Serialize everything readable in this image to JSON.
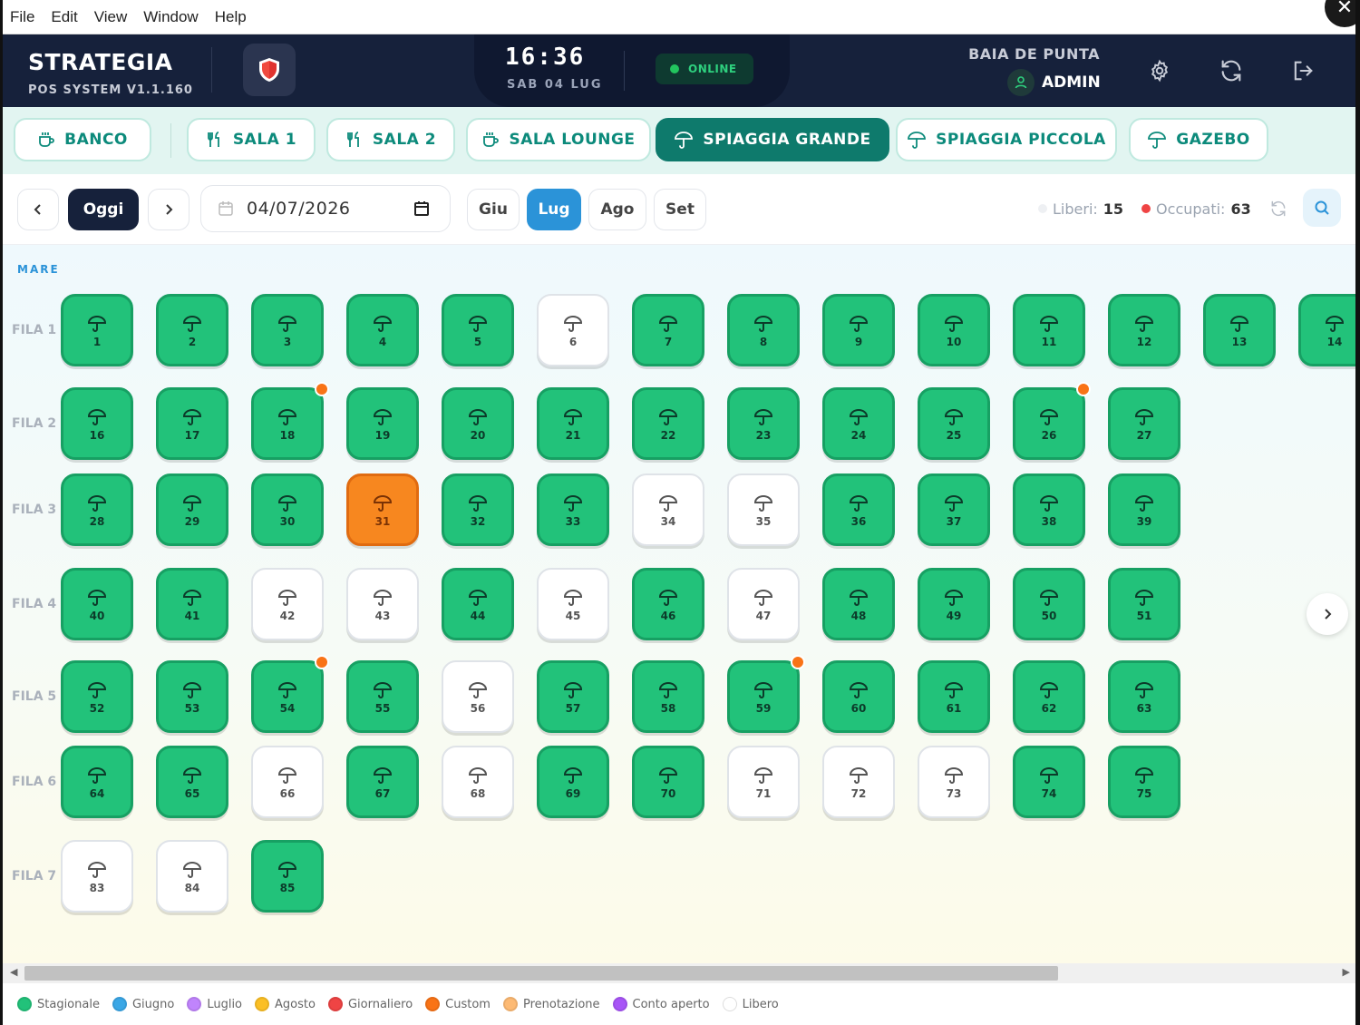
{
  "menu": [
    "File",
    "Edit",
    "View",
    "Window",
    "Help"
  ],
  "header": {
    "brand_title": "STRATEGIA",
    "brand_sub": "POS SYSTEM V1.1.160",
    "time": "16:36",
    "date": "SAB 04 LUG",
    "status": "ONLINE",
    "venue": "BAIA DE PUNTA",
    "user": "ADMIN"
  },
  "tabs": [
    {
      "label": "BANCO",
      "icon": "cup-icon",
      "active": false
    },
    {
      "label": "SALA 1",
      "icon": "utensils-icon",
      "active": false
    },
    {
      "label": "SALA 2",
      "icon": "utensils-icon",
      "active": false
    },
    {
      "label": "SALA LOUNGE",
      "icon": "cup-icon",
      "active": false
    },
    {
      "label": "SPIAGGIA GRANDE",
      "icon": "umbrella-icon",
      "active": true
    },
    {
      "label": "SPIAGGIA PICCOLA",
      "icon": "umbrella-icon",
      "active": false
    },
    {
      "label": "GAZEBO",
      "icon": "umbrella-icon",
      "active": false
    }
  ],
  "toolbar": {
    "today": "Oggi",
    "date_value": "04/07/2026",
    "months": [
      {
        "label": "Giu",
        "active": false
      },
      {
        "label": "Lug",
        "active": true
      },
      {
        "label": "Ago",
        "active": false
      },
      {
        "label": "Set",
        "active": false
      }
    ],
    "free_label": "Liberi:",
    "free_count": "15",
    "occupied_label": "Occupati:",
    "occupied_count": "63"
  },
  "map": {
    "section": "MARE",
    "rows": [
      {
        "label": "FILA 1",
        "spots": [
          {
            "n": "1",
            "s": "stagionale"
          },
          {
            "n": "2",
            "s": "stagionale"
          },
          {
            "n": "3",
            "s": "stagionale"
          },
          {
            "n": "4",
            "s": "stagionale"
          },
          {
            "n": "5",
            "s": "stagionale"
          },
          {
            "n": "6",
            "s": "libero"
          },
          {
            "n": "7",
            "s": "stagionale"
          },
          {
            "n": "8",
            "s": "stagionale"
          },
          {
            "n": "9",
            "s": "stagionale"
          },
          {
            "n": "10",
            "s": "stagionale"
          },
          {
            "n": "11",
            "s": "stagionale"
          },
          {
            "n": "12",
            "s": "stagionale"
          },
          {
            "n": "13",
            "s": "stagionale"
          },
          {
            "n": "14",
            "s": "stagionale"
          }
        ]
      },
      {
        "label": "FILA 2",
        "spots": [
          {
            "n": "16",
            "s": "stagionale"
          },
          {
            "n": "17",
            "s": "stagionale"
          },
          {
            "n": "18",
            "s": "stagionale",
            "badge": true
          },
          {
            "n": "19",
            "s": "stagionale"
          },
          {
            "n": "20",
            "s": "stagionale"
          },
          {
            "n": "21",
            "s": "stagionale"
          },
          {
            "n": "22",
            "s": "stagionale"
          },
          {
            "n": "23",
            "s": "stagionale"
          },
          {
            "n": "24",
            "s": "stagionale"
          },
          {
            "n": "25",
            "s": "stagionale"
          },
          {
            "n": "26",
            "s": "stagionale",
            "badge": true
          },
          {
            "n": "27",
            "s": "stagionale"
          }
        ]
      },
      {
        "label": "FILA 3",
        "spots": [
          {
            "n": "28",
            "s": "stagionale"
          },
          {
            "n": "29",
            "s": "stagionale"
          },
          {
            "n": "30",
            "s": "stagionale"
          },
          {
            "n": "31",
            "s": "custom"
          },
          {
            "n": "32",
            "s": "stagionale"
          },
          {
            "n": "33",
            "s": "stagionale"
          },
          {
            "n": "34",
            "s": "libero"
          },
          {
            "n": "35",
            "s": "libero"
          },
          {
            "n": "36",
            "s": "stagionale"
          },
          {
            "n": "37",
            "s": "stagionale"
          },
          {
            "n": "38",
            "s": "stagionale"
          },
          {
            "n": "39",
            "s": "stagionale"
          }
        ]
      },
      {
        "label": "FILA 4",
        "spots": [
          {
            "n": "40",
            "s": "stagionale"
          },
          {
            "n": "41",
            "s": "stagionale"
          },
          {
            "n": "42",
            "s": "libero"
          },
          {
            "n": "43",
            "s": "libero"
          },
          {
            "n": "44",
            "s": "stagionale"
          },
          {
            "n": "45",
            "s": "libero"
          },
          {
            "n": "46",
            "s": "stagionale"
          },
          {
            "n": "47",
            "s": "libero"
          },
          {
            "n": "48",
            "s": "stagionale"
          },
          {
            "n": "49",
            "s": "stagionale"
          },
          {
            "n": "50",
            "s": "stagionale"
          },
          {
            "n": "51",
            "s": "stagionale"
          }
        ]
      },
      {
        "label": "FILA 5",
        "spots": [
          {
            "n": "52",
            "s": "stagionale"
          },
          {
            "n": "53",
            "s": "stagionale"
          },
          {
            "n": "54",
            "s": "stagionale",
            "badge": true
          },
          {
            "n": "55",
            "s": "stagionale"
          },
          {
            "n": "56",
            "s": "libero"
          },
          {
            "n": "57",
            "s": "stagionale"
          },
          {
            "n": "58",
            "s": "stagionale"
          },
          {
            "n": "59",
            "s": "stagionale",
            "badge": true
          },
          {
            "n": "60",
            "s": "stagionale"
          },
          {
            "n": "61",
            "s": "stagionale"
          },
          {
            "n": "62",
            "s": "stagionale"
          },
          {
            "n": "63",
            "s": "stagionale"
          }
        ]
      },
      {
        "label": "FILA 6",
        "spots": [
          {
            "n": "64",
            "s": "stagionale"
          },
          {
            "n": "65",
            "s": "stagionale"
          },
          {
            "n": "66",
            "s": "libero"
          },
          {
            "n": "67",
            "s": "stagionale"
          },
          {
            "n": "68",
            "s": "libero"
          },
          {
            "n": "69",
            "s": "stagionale"
          },
          {
            "n": "70",
            "s": "stagionale"
          },
          {
            "n": "71",
            "s": "libero"
          },
          {
            "n": "72",
            "s": "libero"
          },
          {
            "n": "73",
            "s": "libero"
          },
          {
            "n": "74",
            "s": "stagionale"
          },
          {
            "n": "75",
            "s": "stagionale"
          }
        ]
      },
      {
        "label": "FILA 7",
        "spots": [
          {
            "n": "83",
            "s": "libero"
          },
          {
            "n": "84",
            "s": "libero"
          },
          {
            "n": "85",
            "s": "stagionale"
          }
        ]
      }
    ]
  },
  "legend": [
    {
      "label": "Stagionale",
      "color": "#22c27a"
    },
    {
      "label": "Giugno",
      "color": "#3aa7e6"
    },
    {
      "label": "Luglio",
      "color": "#c084fc"
    },
    {
      "label": "Agosto",
      "color": "#fbbf24"
    },
    {
      "label": "Giornaliero",
      "color": "#ef4444"
    },
    {
      "label": "Custom",
      "color": "#f97316"
    },
    {
      "label": "Prenotazione",
      "color": "#fdba74"
    },
    {
      "label": "Conto aperto",
      "color": "#a855f7"
    },
    {
      "label": "Libero",
      "color": "#ffffff"
    }
  ]
}
